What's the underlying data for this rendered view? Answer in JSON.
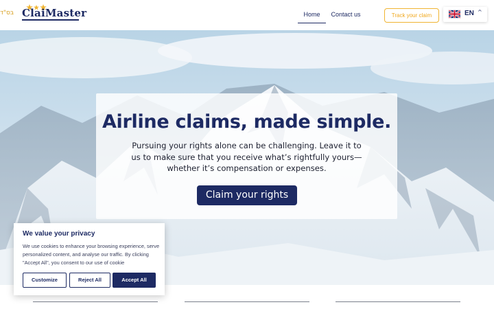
{
  "header": {
    "rtl_hint": "בס\"ד",
    "logo_text": "ClaiMaster",
    "nav": {
      "home": "Home",
      "contact": "Contact us"
    },
    "track_claim": "Track your claim",
    "language": {
      "code": "EN",
      "chevron": "^"
    }
  },
  "hero": {
    "title": "Airline claims, made simple.",
    "text": "Pursuing your rights alone can be challenging. Leave it to us to make sure that you receive what’s rightfully yours—whether it’s compensation or expenses.",
    "cta": "Claim your rights"
  },
  "cookie": {
    "title": "We value your privacy",
    "text": "We use cookies to enhance your browsing experience, serve personalized content, and analyse our traffic. By clicking \"Accept All\", you consent to our use of cookie",
    "customize": "Customize",
    "reject": "Reject All",
    "accept": "Accept All"
  },
  "colors": {
    "brand": "#1d2a63",
    "accent": "#f0b431"
  },
  "icons": {
    "flag": "uk-flag-icon",
    "chevron": "chevron-up-icon",
    "stars": "logo-stars-icon"
  }
}
